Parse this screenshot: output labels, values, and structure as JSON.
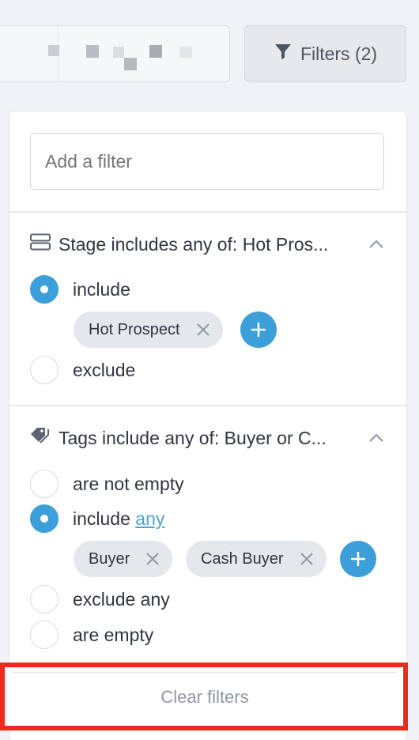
{
  "toolbar": {
    "filters_label": "Filters (2)"
  },
  "panel": {
    "add_filter_placeholder": "Add a filter",
    "stage": {
      "title": "Stage includes any of: Hot Pros...",
      "options": [
        "include",
        "exclude"
      ],
      "selected": "include",
      "chips": [
        "Hot Prospect"
      ]
    },
    "tags": {
      "title": "Tags include any of: Buyer or C...",
      "options": {
        "not_empty": "are not empty",
        "include": "include",
        "include_link": "any",
        "exclude_any": "exclude any",
        "empty": "are empty"
      },
      "selected": "include",
      "chips": [
        "Buyer",
        "Cash Buyer"
      ]
    },
    "clear_label": "Clear filters"
  },
  "colors": {
    "accent": "#3d9fd9",
    "highlight_border": "#ee2a1e"
  }
}
